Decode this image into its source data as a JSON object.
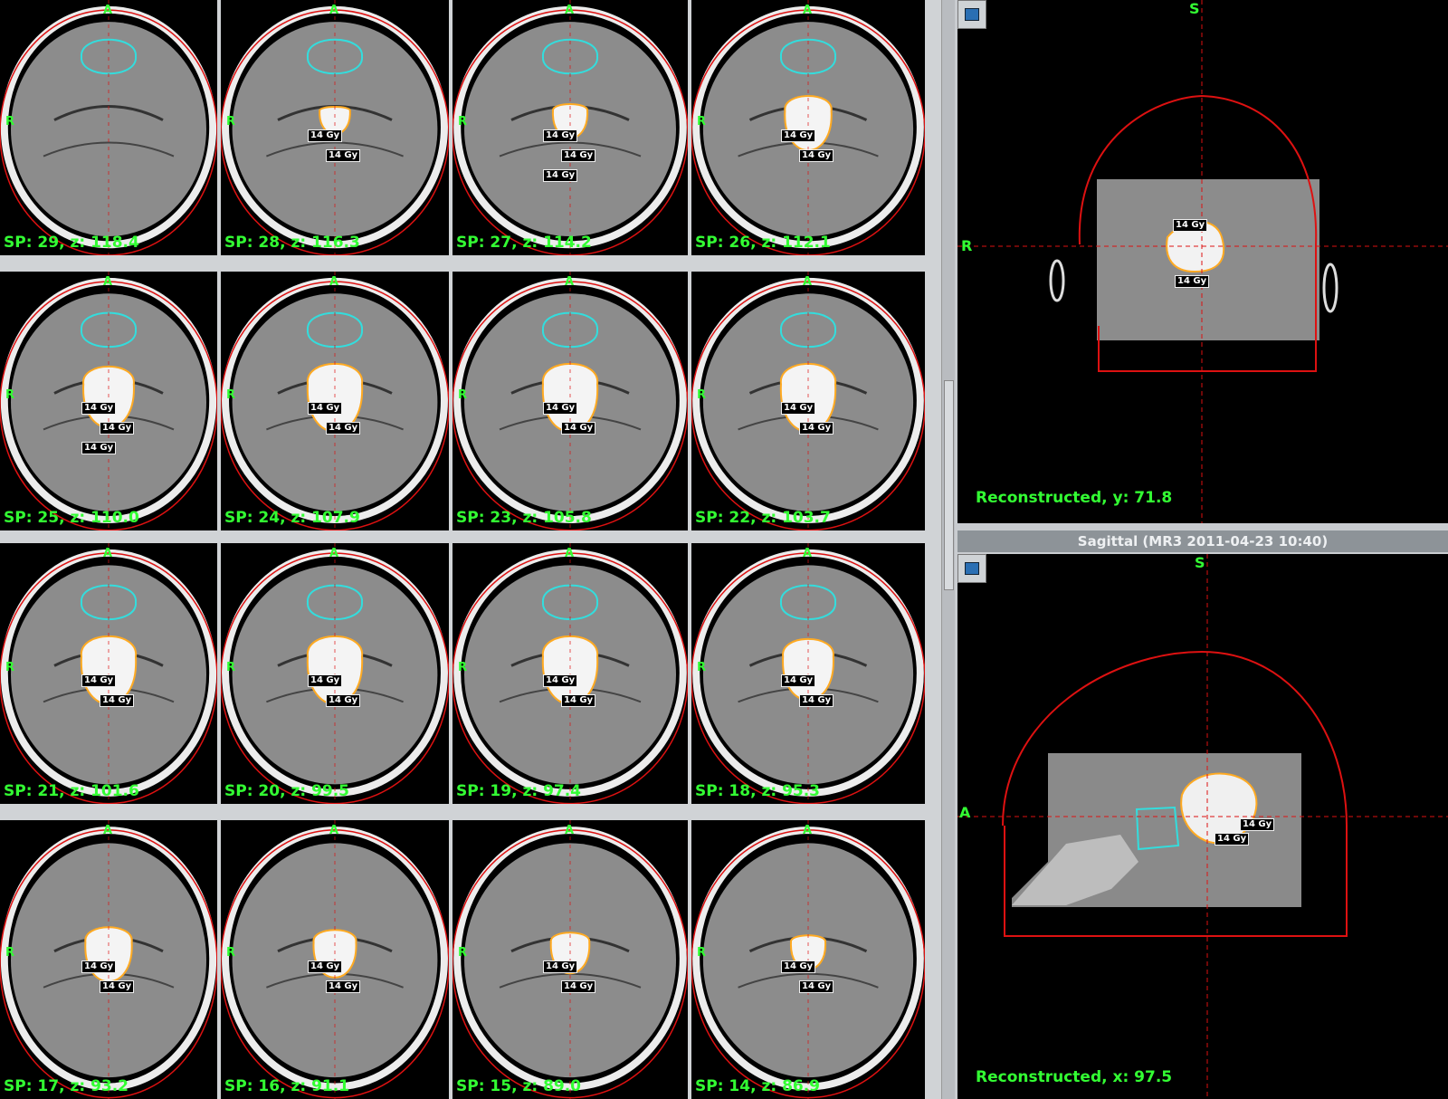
{
  "slices": [
    {
      "label": "SP: 29, z: 118.4",
      "doses": []
    },
    {
      "label": "SP: 28, z: 116.3",
      "doses": [
        "14 Gy",
        "14 Gy"
      ]
    },
    {
      "label": "SP: 27, z: 114.2",
      "doses": [
        "14 Gy",
        "14 Gy",
        "14 Gy"
      ]
    },
    {
      "label": "SP: 26, z: 112.1",
      "doses": [
        "14 Gy",
        "14 Gy"
      ]
    },
    {
      "label": "SP: 25, z: 110.0",
      "doses": [
        "14 Gy",
        "14 Gy",
        "14 Gy"
      ]
    },
    {
      "label": "SP: 24, z: 107.9",
      "doses": [
        "14 Gy",
        "14 Gy"
      ]
    },
    {
      "label": "SP: 23, z: 105.8",
      "doses": [
        "14 Gy",
        "14 Gy"
      ]
    },
    {
      "label": "SP: 22, z: 103.7",
      "doses": [
        "14 Gy",
        "14 Gy"
      ]
    },
    {
      "label": "SP: 21, z: 101.6",
      "doses": [
        "14 Gy",
        "14 Gy"
      ]
    },
    {
      "label": "SP: 20, z: 99.5",
      "doses": [
        "14 Gy",
        "14 Gy"
      ]
    },
    {
      "label": "SP: 19, z: 97.4",
      "doses": [
        "14 Gy",
        "14 Gy"
      ]
    },
    {
      "label": "SP: 18, z: 95.3",
      "doses": [
        "14 Gy",
        "14 Gy"
      ]
    },
    {
      "label": "SP: 17, z: 93.2",
      "doses": [
        "14 Gy",
        "14 Gy"
      ]
    },
    {
      "label": "SP: 16, z: 91.1",
      "doses": [
        "14 Gy",
        "14 Gy"
      ]
    },
    {
      "label": "SP: 15, z: 89.0",
      "doses": [
        "14 Gy",
        "14 Gy"
      ]
    },
    {
      "label": "SP: 14, z: 86.9",
      "doses": [
        "14 Gy",
        "14 Gy"
      ]
    }
  ],
  "orientation": {
    "anterior": "A",
    "right": "R",
    "superior": "S"
  },
  "coronal": {
    "caption": "Reconstructed, y: 71.8",
    "doses": [
      "14 Gy",
      "14 Gy"
    ]
  },
  "sagittal": {
    "title": "Sagittal (MR3 2011-04-23 10:40)",
    "caption": "Reconstructed, x: 97.5",
    "doses": [
      "14 Gy",
      "14 Gy"
    ]
  },
  "colors": {
    "label": "#33ff33",
    "target_contour": "#ffaa22",
    "brainstem_contour": "#33dddd",
    "body_contour": "#dd1111"
  }
}
